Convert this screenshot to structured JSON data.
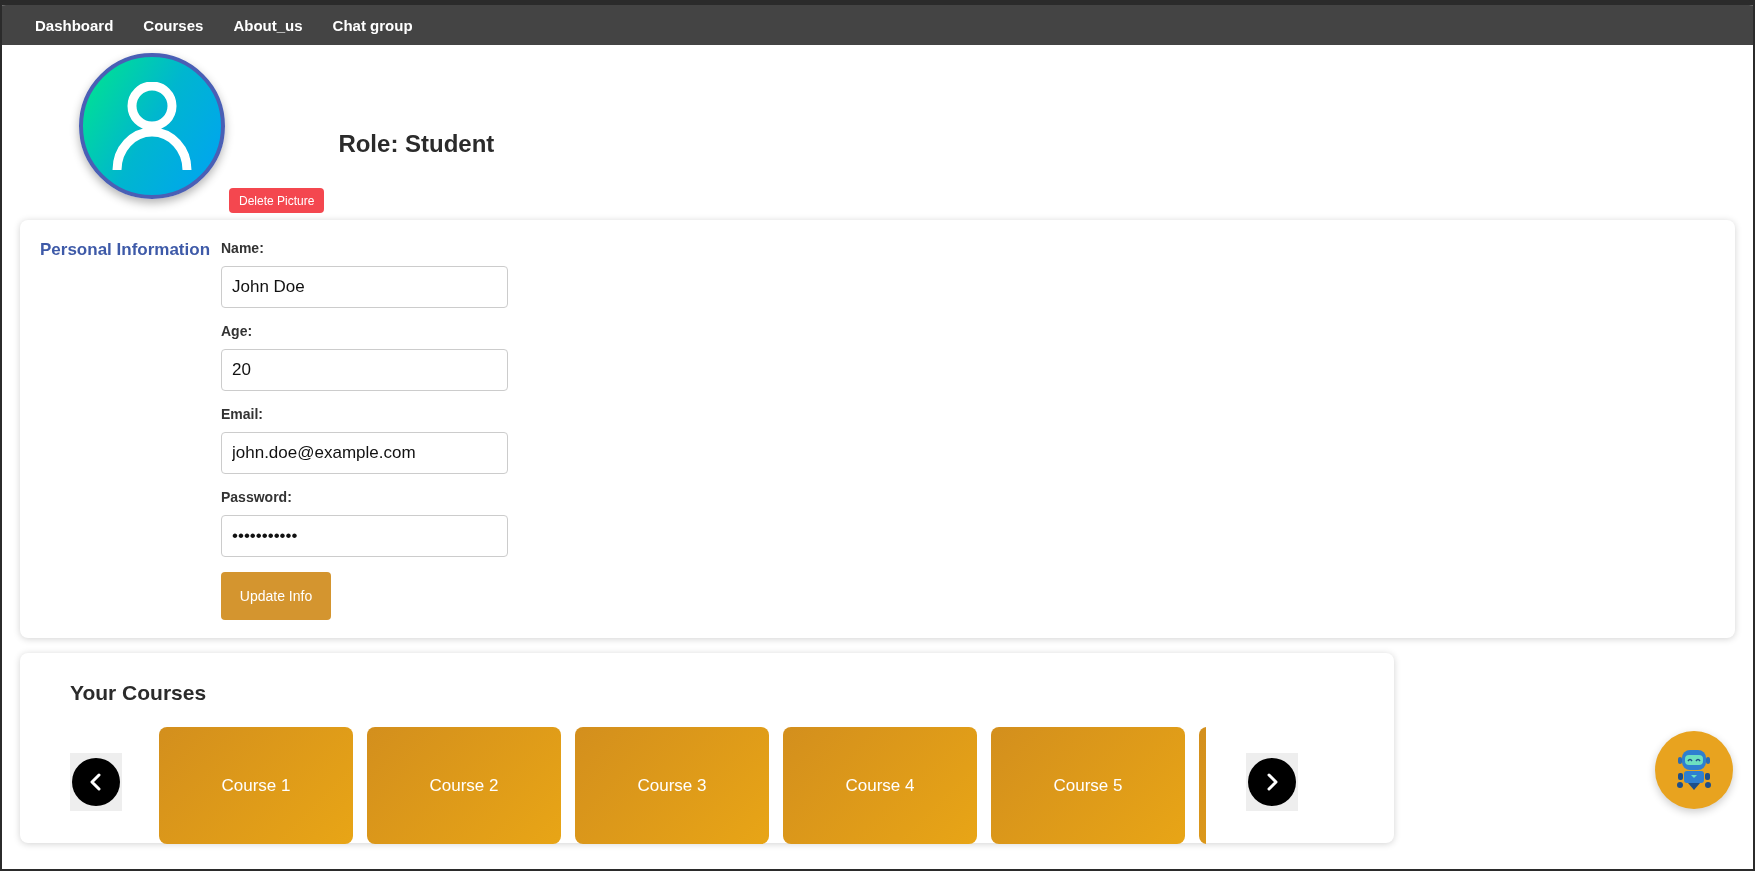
{
  "nav": {
    "items": [
      {
        "label": "Dashboard"
      },
      {
        "label": "Courses"
      },
      {
        "label": "About_us"
      },
      {
        "label": "Chat group"
      }
    ]
  },
  "profile": {
    "role": "Role: Student",
    "delete_button": "Delete Picture"
  },
  "personal_info": {
    "title": "Personal Information",
    "fields": [
      {
        "label": "Name:",
        "value": "John Doe"
      },
      {
        "label": "Age:",
        "value": "20"
      },
      {
        "label": "Email:",
        "value": "john.doe@example.com"
      },
      {
        "label": "Password:",
        "value": "•••••••••••"
      }
    ],
    "button": "Update Info"
  },
  "courses": {
    "title": "Your Courses",
    "items": [
      {
        "label": "Course 1"
      },
      {
        "label": "Course 2"
      },
      {
        "label": "Course 3"
      },
      {
        "label": "Course 4"
      },
      {
        "label": "Course 5"
      }
    ]
  }
}
